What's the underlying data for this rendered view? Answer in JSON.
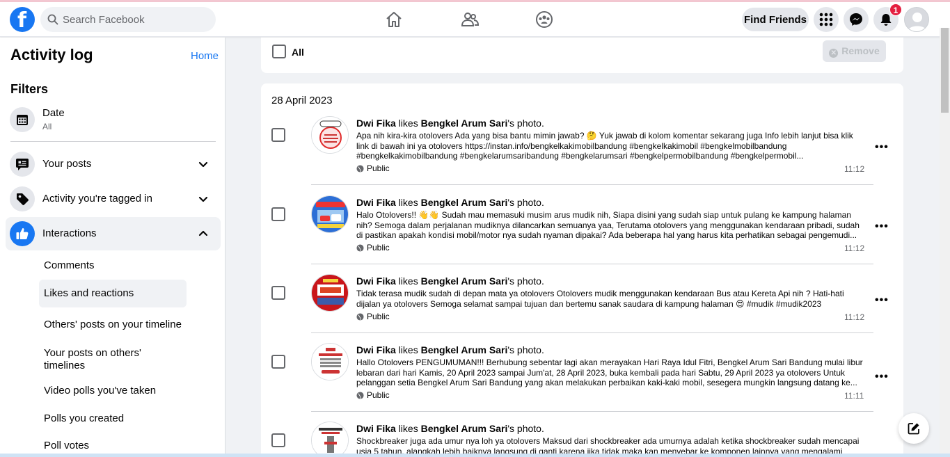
{
  "header": {
    "search_placeholder": "Search Facebook",
    "find_friends": "Find Friends",
    "notification_count": "1",
    "logo_letter": "f"
  },
  "sidebar": {
    "title": "Activity log",
    "home_link": "Home",
    "filters_title": "Filters",
    "date": {
      "label": "Date",
      "value": "All"
    },
    "sections": [
      {
        "label": "Your posts",
        "icon": "posts-icon",
        "expanded": false
      },
      {
        "label": "Activity you're tagged in",
        "icon": "tag-icon",
        "expanded": false
      },
      {
        "label": "Interactions",
        "icon": "thumbs-up-icon",
        "expanded": true
      }
    ],
    "interactions_items": [
      "Comments",
      "Likes and reactions",
      "Others' posts on your timeline",
      "Your posts on others' timelines",
      "Video polls you've taken",
      "Polls you created",
      "Poll votes"
    ],
    "selected_item": "Likes and reactions"
  },
  "main": {
    "select_all": "All",
    "remove_button": "Remove",
    "day_title": "28 April 2023",
    "entries": [
      {
        "actor": "Dwi Fika",
        "verb": "likes",
        "page": "Bengkel Arum Sari",
        "suffix": "'s photo.",
        "text": "Apa nih kira-kira otolovers Ada yang bisa bantu mimin jawab? 🤔 Yuk jawab di kolom komentar sekarang juga Info lebih lanjut bisa klik link di bawah ini ya otolovers https://instan.info/bengkelkakimobilbandung #bengkelkakimobil #bengkelmobilbandung #bengkelkakimobilbandung #bengkelarumsaribandung #bengkelarumsari #bengkelpermobilbandung #bengkelpermobil...",
        "audience": "Public",
        "time": "11:12"
      },
      {
        "actor": "Dwi Fika",
        "verb": "likes",
        "page": "Bengkel Arum Sari",
        "suffix": "'s photo.",
        "text": "Halo Otolovers!! 👋👋 Sudah mau memasuki musim arus mudik nih, Siapa disini yang sudah siap untuk pulang ke kampung halaman nih? Semoga dalam perjalanan mudiknya dilancarkan semuanya yaa, Terutama otolovers yang menggunakan kendaraan pribadi, sudah di pastikan apakah kondisi mobil/motor nya sudah nyaman dipakai? Ada beberapa hal yang harus kita perhatikan sebagai pengemudi...",
        "audience": "Public",
        "time": "11:12"
      },
      {
        "actor": "Dwi Fika",
        "verb": "likes",
        "page": "Bengkel Arum Sari",
        "suffix": "'s photo.",
        "text": "Tidak terasa mudik sudah di depan mata ya otolovers Otolovers mudik menggunakan kendaraan Bus atau Kereta Api nih ? Hati-hati dijalan ya otolovers Semoga selamat sampai tujuan dan bertemu sanak saudara di kampung halaman 😍 #mudik #mudik2023 #mudiklebaran",
        "audience": "Public",
        "time": "11:12"
      },
      {
        "actor": "Dwi Fika",
        "verb": "likes",
        "page": "Bengkel Arum Sari",
        "suffix": "'s photo.",
        "text": "Hallo Otolovers PENGUMUMAN!!! Berhubung sebentar lagi akan merayakan Hari Raya Idul Fitri, Bengkel Arum Sari Bandung mulai libur lebaran dari hari Kamis, 20 April 2023 sampai Jum'at, 28 April 2023, buka kembali pada hari Sabtu, 29 April 2023 ya otolovers Untuk pelanggan setia Bengkel Arum Sari Bandung yang akan melakukan perbaikan kaki-kaki mobil, sesegera mungkin langsung datang ke...",
        "audience": "Public",
        "time": "11:11"
      },
      {
        "actor": "Dwi Fika",
        "verb": "likes",
        "page": "Bengkel Arum Sari",
        "suffix": "'s photo.",
        "text": "Shockbreaker juga ada umur nya loh ya otolovers Maksud dari shockbreaker ada umurnya adalah ketika shockbreaker sudah mencapai usia 5 tahun, alangkah lebih baiknya langsung di ganti karena jika tidak maka kan menyebar ke komponen lainnya yang mengalami penurunan",
        "audience": "Public",
        "time": ""
      }
    ]
  },
  "colors": {
    "brand": "#1877f2",
    "badge": "#e41e3f",
    "background": "#f0f2f5"
  }
}
